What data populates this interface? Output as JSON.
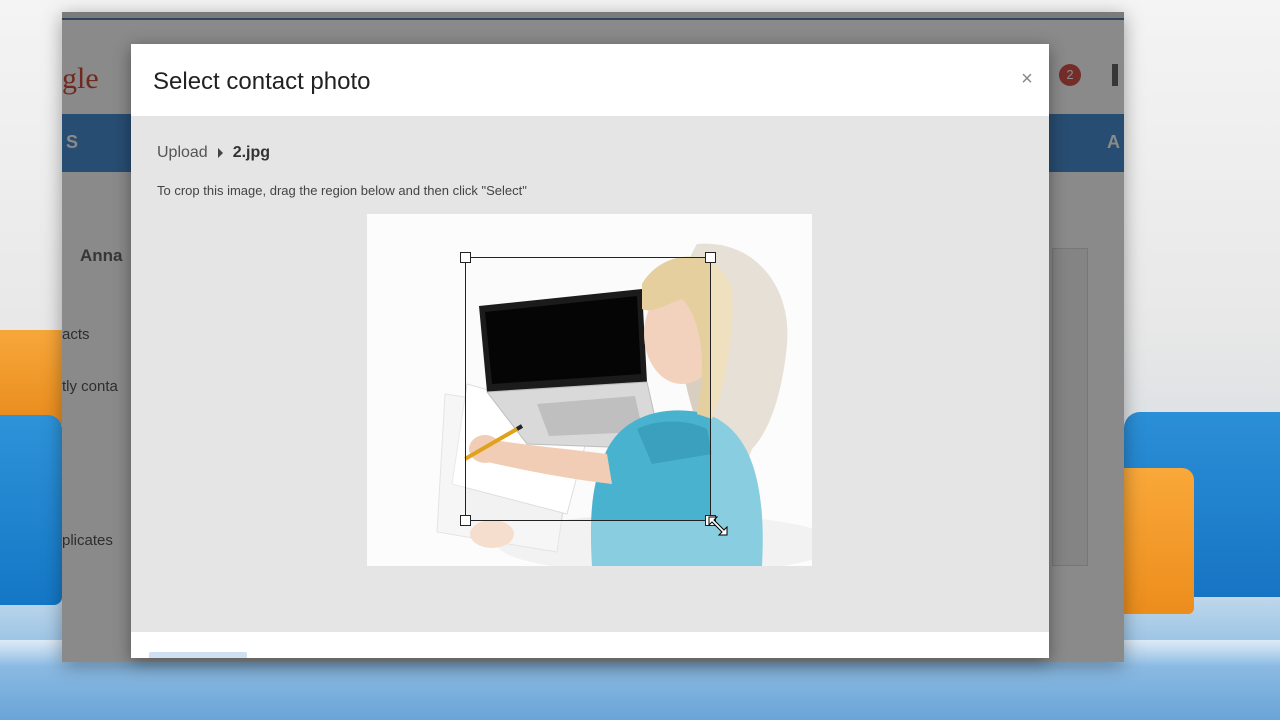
{
  "dialog": {
    "title": "Select contact photo",
    "close_label": "×",
    "breadcrumb": {
      "upload_label": "Upload",
      "file_name": "2.jpg"
    },
    "instructions": "To crop this image, drag the region below and then click \"Select\""
  },
  "background_page": {
    "logo_fragment": "gle",
    "notification_count": "2",
    "bar_left_text": "S",
    "bar_right_text": "A",
    "contact_name_fragment": "Anna",
    "side_items": [
      "acts",
      "tly conta",
      "plicates"
    ]
  },
  "colors": {
    "accent_blue": "#4a8fd3",
    "dialog_body_bg": "#e5e5e5",
    "badge_red": "#d9534f"
  }
}
